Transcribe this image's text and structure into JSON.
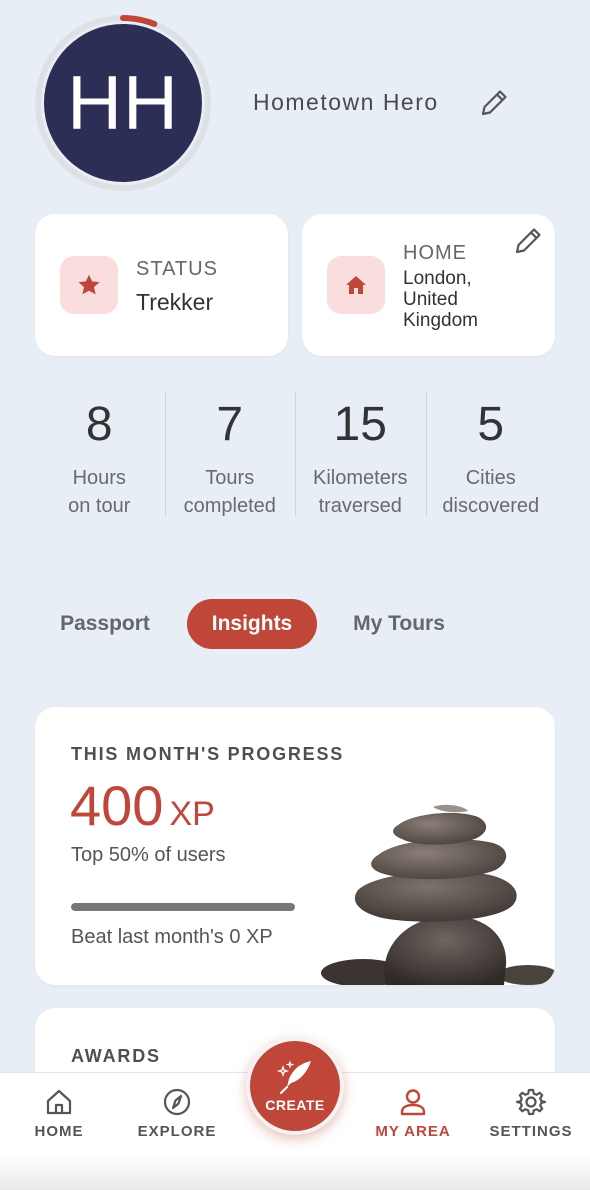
{
  "profile": {
    "initials": "HH",
    "name": "Hometown Hero",
    "level_progress": 0.06
  },
  "status_card": {
    "label": "STATUS",
    "value": "Trekker"
  },
  "home_card": {
    "label": "HOME",
    "value_line1": "London,",
    "value_line2": "United",
    "value_line3": "Kingdom"
  },
  "stats": [
    {
      "value": "8",
      "line1": "Hours",
      "line2": "on tour"
    },
    {
      "value": "7",
      "line1": "Tours",
      "line2": "completed"
    },
    {
      "value": "15",
      "line1": "Kilometers",
      "line2": "traversed"
    },
    {
      "value": "5",
      "line1": "Cities",
      "line2": "discovered"
    }
  ],
  "tabs": {
    "passport": "Passport",
    "insights": "Insights",
    "my_tours": "My Tours",
    "active": "insights"
  },
  "progress": {
    "title": "THIS MONTH'S PROGRESS",
    "xp_value": "400",
    "xp_unit": "XP",
    "rank": "Top 50% of users",
    "bar_fill": 1.0,
    "beat": "Beat last month's 0 XP"
  },
  "awards": {
    "title": "AWARDS"
  },
  "nav": {
    "home": "HOME",
    "explore": "EXPLORE",
    "create": "CREATE",
    "my_area": "MY AREA",
    "settings": "SETTINGS",
    "active": "my_area"
  },
  "colors": {
    "accent": "#c0463a",
    "avatar_bg": "#2c2e55",
    "page_bg": "#e8eef5",
    "icon_bg": "#f9dedd"
  },
  "icons": {
    "status": "star-icon",
    "home": "house-icon",
    "edit": "pencil-icon",
    "nav_home": "home-outline-icon",
    "nav_explore": "compass-icon",
    "nav_create": "feather-sparkle-icon",
    "nav_my_area": "person-icon",
    "nav_settings": "gear-icon"
  }
}
